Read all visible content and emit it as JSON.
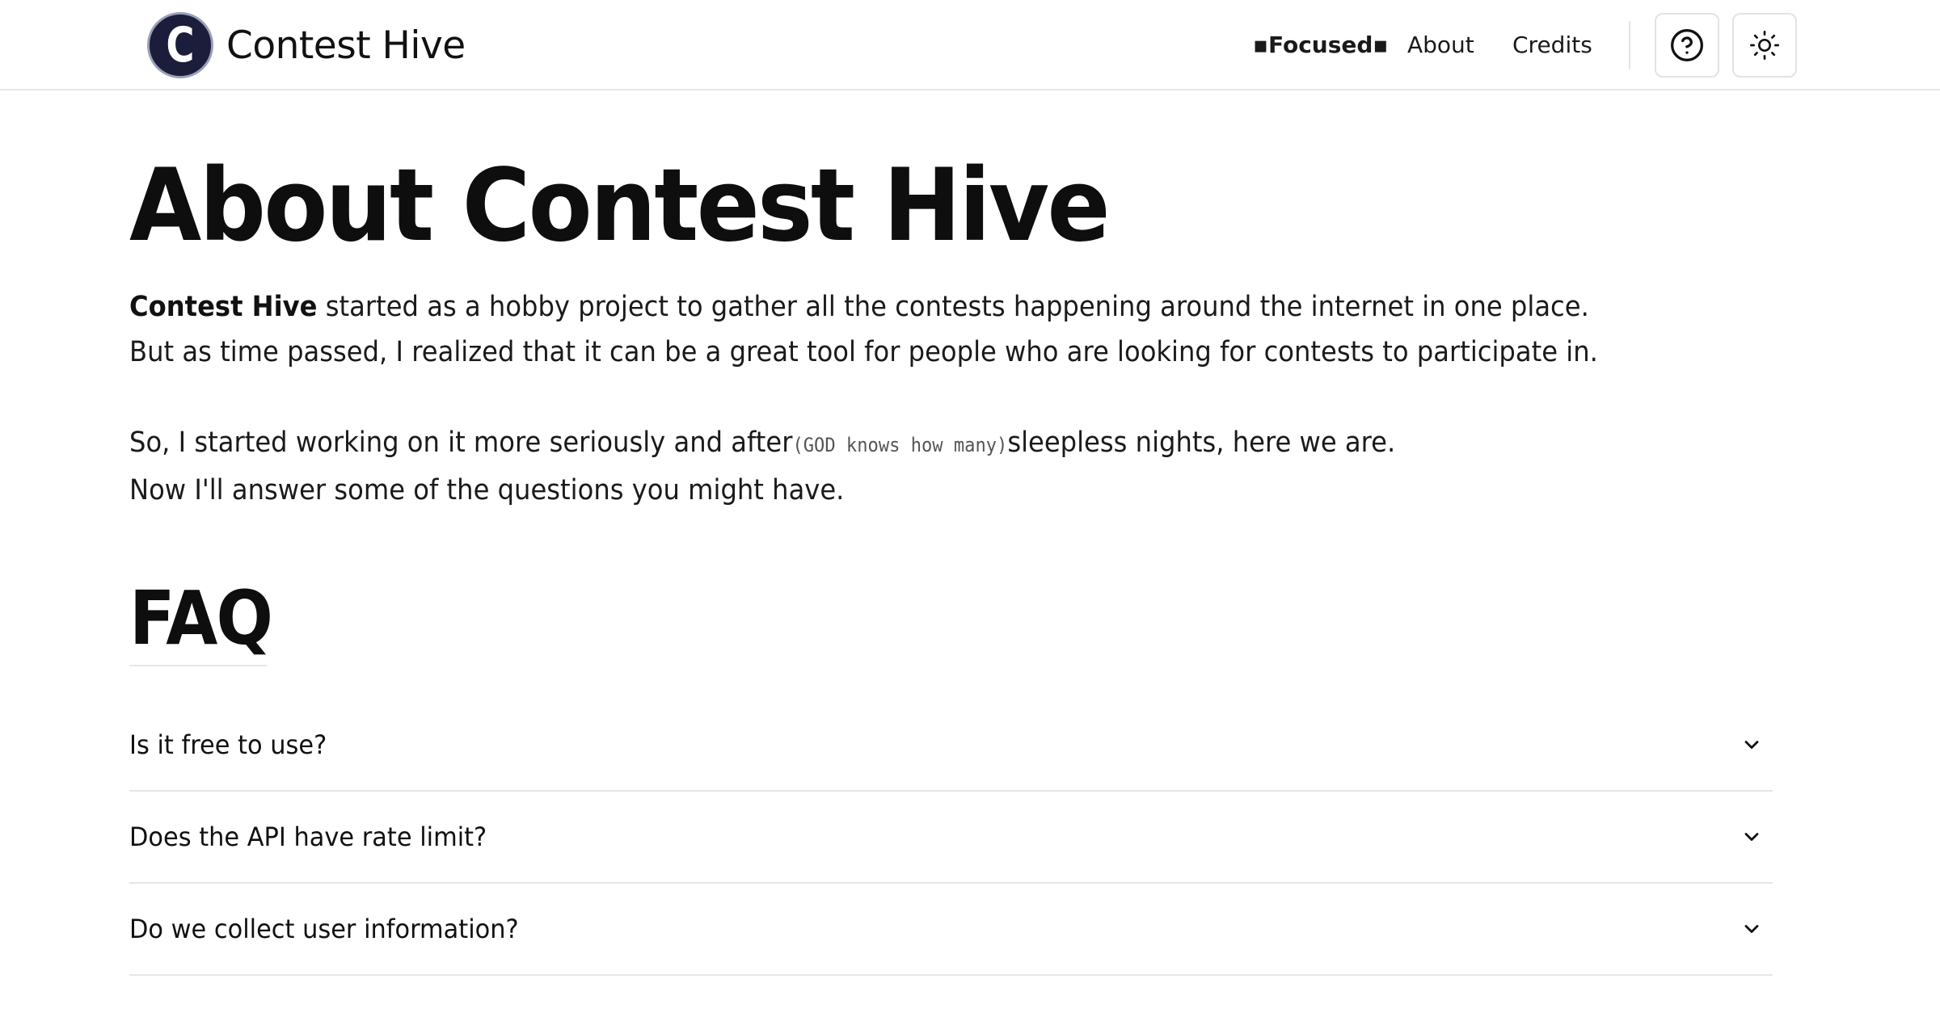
{
  "header": {
    "brand_name": "Contest Hive",
    "logo_letter": "C",
    "nav": {
      "focused": "▪Focused▪",
      "about": "About",
      "credits": "Credits"
    },
    "help_icon": "question-circle-icon",
    "theme_icon": "sun-icon"
  },
  "main": {
    "title": "About Contest Hive",
    "intro": {
      "brand_bold": "Contest Hive",
      "line1_rest": " started as a hobby project to gather all the contests happening around the internet in one place.",
      "line2": "But as time passed, I realized that it can be a great tool for people who are looking for contests to participate in.",
      "line3_start": "So, I started working on it more seriously and after",
      "line3_aside": "(GOD knows how many)",
      "line3_end": "sleepless nights, here we are.",
      "line4": "Now I'll answer some of the questions you might have."
    }
  },
  "faq": {
    "heading": "FAQ",
    "items": [
      {
        "question": "Is it free to use?"
      },
      {
        "question": "Does the API have rate limit?"
      },
      {
        "question": "Do we collect user information?"
      }
    ]
  },
  "colors": {
    "logo_bg": "#1b1d3a",
    "text": "#111111",
    "divider": "#e6e6e6"
  }
}
